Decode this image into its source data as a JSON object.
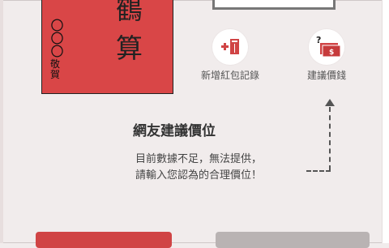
{
  "envelope": {
    "char_top": "鶴",
    "char_bottom": "算",
    "recipient_placeholder": "〇〇〇",
    "sender_label": "敬賀"
  },
  "actions": {
    "add_record_label": "新增紅包記錄",
    "suggest_price_label": "建議價錢"
  },
  "main": {
    "headline": "網友建議價位",
    "message_line1": "目前數據不足，無法提供，",
    "message_line2": "請輸入您認為的合理價位！"
  },
  "colors": {
    "accent_red": "#d94647",
    "button_red": "#d04445",
    "button_gray": "#b9b3b3",
    "background": "#f1ecec"
  },
  "icons": {
    "add_record": "add-envelope-icon",
    "suggest_price": "price-question-icon"
  }
}
